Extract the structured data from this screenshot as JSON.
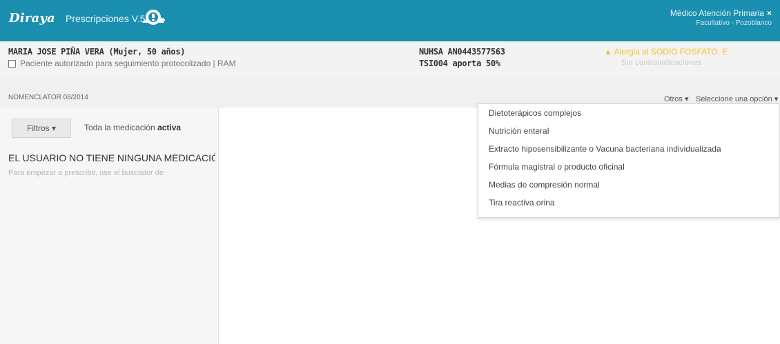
{
  "header": {
    "logo": "Diraya",
    "app_title": "Prescripciones V.5",
    "icon": "prescription-app-icon",
    "user_name": "Médico Atención Primaria",
    "close": "×",
    "user_role": "Facultativo - Pozoblanco"
  },
  "patient": {
    "name": "MARIA JOSE PIÑA VERA (Mujer, 50 años)",
    "checkbox_label": "Paciente autorizado para seguimiento protocolizado  |  RAM",
    "nuhsa": "NUHSA AN0443577563",
    "ts": "TSI004 aporta 50%",
    "alert_icon": "▲",
    "alert": "Alergia al SODIO FOSFATO, E",
    "contraindications": "Sin contraindicaciones"
  },
  "subbar": {
    "nomenclator": "NOMENCLATOR 08/2014",
    "otros": "Otros ▾",
    "select": "Seleccione una opción   ▾"
  },
  "left": {
    "filter_button": "Filtros ▾",
    "filter_text_prefix": "Toda la medicación ",
    "filter_text_bold": "activa",
    "empty_title": "EL USUARIO NO TIENE NINGUNA MEDICACIÓN",
    "empty_help": "Para empezar a prescribir, use el buscador de"
  },
  "dropdown": {
    "items": [
      "Dietoterápicos complejos",
      "Nutrición enteral",
      "Extracto hiposensibilizante o Vacuna bacteriana individualizada",
      "Fórmula magistral o producto oficinal",
      "Medias de compresión normal",
      "Tira reactiva orina"
    ]
  },
  "colors": {
    "topbar": "#1b8fb0",
    "alert": "#f1c232"
  }
}
